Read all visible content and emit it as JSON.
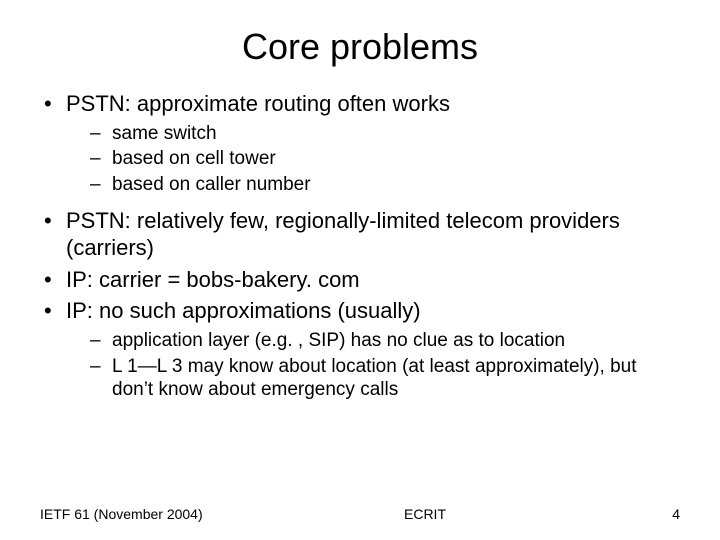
{
  "title": "Core problems",
  "bullets": [
    {
      "text": "PSTN: approximate routing often works",
      "sub": [
        "same switch",
        "based on cell tower",
        "based on caller number"
      ]
    },
    {
      "text": "PSTN: relatively few, regionally-limited telecom providers (carriers)",
      "sub": []
    },
    {
      "text": "IP: carrier = bobs-bakery. com",
      "sub": []
    },
    {
      "text": "IP: no such approximations (usually)",
      "sub": [
        "application layer (e.g. , SIP) has no clue as to location",
        "L 1—L 3 may know about location (at least approximately), but don’t know about emergency calls"
      ]
    }
  ],
  "footer": {
    "left": "IETF 61 (November 2004)",
    "center": "ECRIT",
    "right": "4"
  }
}
